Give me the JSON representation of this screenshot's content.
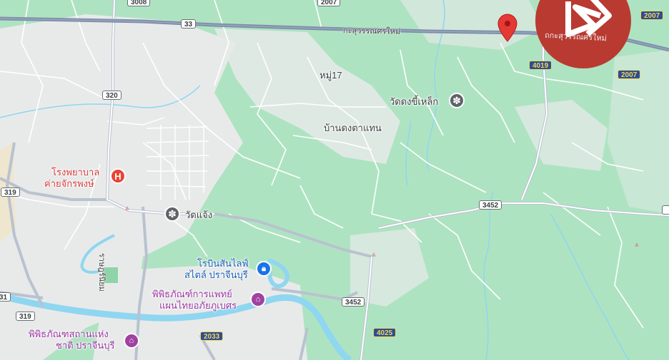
{
  "colors": {
    "forest": "#a9e2bf",
    "urban": "#e8e9ea",
    "water": "#8fd6f0",
    "highway": "#7d8eab",
    "pin": "#e53935",
    "hospital": "#ea4335",
    "museum": "#a142a0",
    "shopping": "#1a73e8",
    "temple": "#5f6368",
    "brand": "#b93a31"
  },
  "places": {
    "hospital": "โรงพยาบาลค่ายจักรพงษ์",
    "hospital_line1": "โรงพยาบาล",
    "hospital_line2": "ค่ายจักรพงษ์",
    "wat_chaeng": "วัดแจ้ง",
    "robinson_line1": "โรบินสันไลฟ์",
    "robinson_line2": "สไตล์ ปราจีนบุรี",
    "medical_museum_line1": "พิพิธภัณฑ์การแพทย์",
    "medical_museum_line2": "แผนไทยอภัยภูเบศร",
    "national_museum_line1": "พิพิธภัณฑสถานแห่ง",
    "national_museum_line2": "ชาติ ปราจีนบุรี",
    "wat_dong_khi_lek": "วัดดงขี้เหล็ก",
    "ban_dong_ta_haen": "บ้านดงตาแทน",
    "moo17": "หมู่17"
  },
  "roads": {
    "highway_name": "กะสุวรรณศรใหม่",
    "highway_name_right": "ถกะสุวรรณศรใหม่",
    "r33": "33",
    "r320": "320",
    "r319a": "319",
    "r319b": "319",
    "r3452a": "3452",
    "r3452b": "3452",
    "r4019": "4019",
    "r2007a": "2007",
    "r2007b": "2007",
    "r4025": "4025",
    "r2033": "2033",
    "r3008": "3008",
    "r2007top": "2007",
    "r31": "31",
    "street_vertical": "ราษฎร์นิยม"
  },
  "icons": {
    "hospital": "hospital-icon",
    "temple": "temple-icon",
    "shopping": "shopping-bag-icon",
    "museum": "museum-icon",
    "pin": "location-pin-icon",
    "brand": "brand-logo-icon"
  }
}
